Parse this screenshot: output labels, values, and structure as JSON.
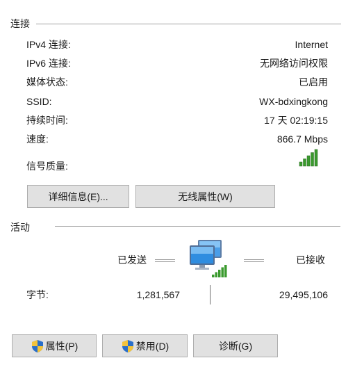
{
  "connection": {
    "title": "连接",
    "rows": [
      {
        "label": "IPv4 连接:",
        "value": "Internet"
      },
      {
        "label": "IPv6 连接:",
        "value": "无网络访问权限"
      },
      {
        "label": "媒体状态:",
        "value": "已启用"
      },
      {
        "label": "SSID:",
        "value": "WX-bdxingkong"
      },
      {
        "label": "持续时间:",
        "value": "17 天 02:19:15"
      },
      {
        "label": "速度:",
        "value": "866.7 Mbps"
      }
    ],
    "signal_label": "信号质量:",
    "signal_bars": 5,
    "signal_max": 5,
    "details_button": "详细信息(E)...",
    "wireless_props_button": "无线属性(W)"
  },
  "activity": {
    "title": "活动",
    "sent_label": "已发送",
    "received_label": "已接收",
    "bytes_label": "字节:",
    "bytes_sent": "1,281,567",
    "bytes_received": "29,495,106"
  },
  "buttons": {
    "properties": "属性(P)",
    "disable": "禁用(D)",
    "diagnose": "诊断(G)"
  },
  "colors": {
    "signal_green": "#3a9a2e",
    "button_bg": "#e1e1e1",
    "button_border": "#adadad",
    "shield_blue": "#2a6fc9",
    "shield_yellow": "#f3c33c"
  }
}
